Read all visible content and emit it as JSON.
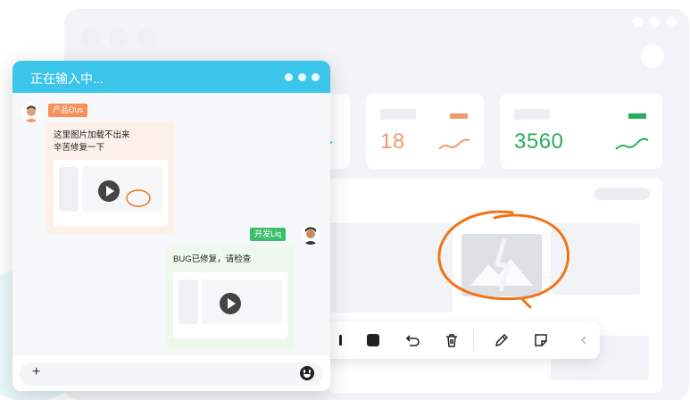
{
  "chat": {
    "title": "正在输入中...",
    "messages": [
      {
        "sender_tag": "产品Dus",
        "lines": [
          "这里图片加载不出来",
          "辛苦修复一下"
        ],
        "side": "left"
      },
      {
        "sender_tag": "开发Liq",
        "lines": [
          "BUG已修复，请检查"
        ],
        "side": "right"
      }
    ],
    "input_plus": "+"
  },
  "stats": [
    {
      "value": "18",
      "color": "#f29a6b"
    },
    {
      "value": "3560",
      "color": "#27ad60"
    }
  ],
  "colors": {
    "chat_header": "#3bc5ea",
    "product_tag": "#f6915a",
    "dev_tag": "#3bbf6a",
    "bubble_left": "#fdf0e8",
    "bubble_right": "#eef8ee",
    "annotation": "#f27417"
  },
  "toolbar": {
    "tools": [
      "pause-icon",
      "stop-icon",
      "undo-icon",
      "trash-icon",
      "pen-icon",
      "sticky-note-icon",
      "chevron-left-icon"
    ]
  }
}
